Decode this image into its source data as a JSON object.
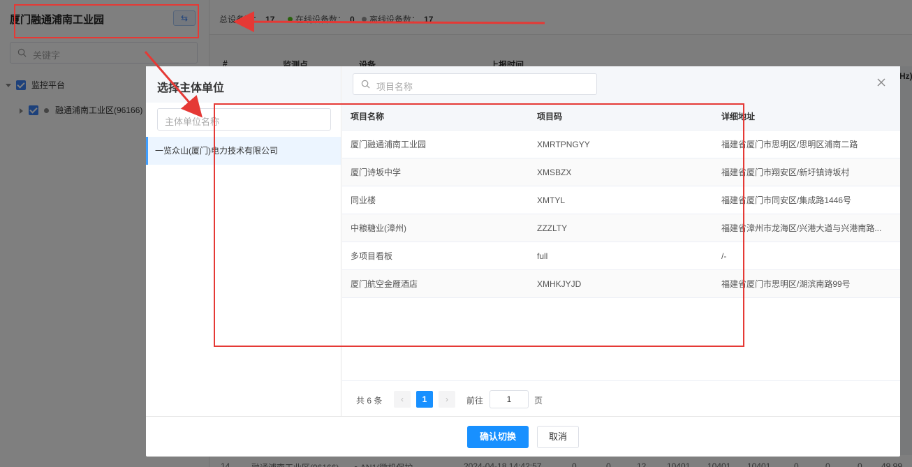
{
  "background": {
    "sidebar": {
      "title": "厦门融通浦南工业园",
      "switch_icon": "swap-icon",
      "search_placeholder": "关键字",
      "tree": [
        {
          "label": "监控平台"
        },
        {
          "label": "融通浦南工业区(96166)"
        }
      ]
    },
    "stats": [
      {
        "label": "总设备数：",
        "value": "17",
        "color": ""
      },
      {
        "label": "在线设备数：",
        "value": "0",
        "color": "#52c41a"
      },
      {
        "label": "离线设备数：",
        "value": "17",
        "color": "#999999"
      }
    ],
    "table_headers": [
      "#",
      "监测点",
      "设备",
      "上报时间",
      "Hz)"
    ],
    "bottom_row": [
      "14",
      "融通浦南工业区(96166)",
      "● AN1(微机保护",
      "2024-04-18 14:42:57",
      "0",
      "0",
      "12",
      "10401",
      "10401",
      "10401",
      "0",
      "0",
      "0",
      "49.99"
    ]
  },
  "dialog": {
    "title": "选择主体单位",
    "left_search_placeholder": "主体单位名称",
    "units": [
      {
        "name": "一览众山(厦门)电力技术有限公司"
      }
    ],
    "right_search_placeholder": "项目名称",
    "close_icon": "close-icon",
    "table": {
      "headers": [
        "项目名称",
        "项目码",
        "详细地址"
      ],
      "rows": [
        {
          "name": "厦门融通浦南工业园",
          "code": "XMRTPNGYY",
          "address": "福建省厦门市思明区/思明区浦南二路"
        },
        {
          "name": "厦门诗坂中学",
          "code": "XMSBZX",
          "address": "福建省厦门市翔安区/新圩镇诗坂村"
        },
        {
          "name": "同业楼",
          "code": "XMTYL",
          "address": "福建省厦门市同安区/集成路1446号"
        },
        {
          "name": "中粮糖业(漳州)",
          "code": "ZZZLTY",
          "address": "福建省漳州市龙海区/兴港大道与兴港南路..."
        },
        {
          "name": "多项目看板",
          "code": "full",
          "address": "/-"
        },
        {
          "name": "厦门航空金雁酒店",
          "code": "XMHKJYJD",
          "address": "福建省厦门市思明区/湖滨南路99号"
        }
      ]
    },
    "pagination": {
      "total": "共 6 条",
      "prev": "‹",
      "current": "1",
      "next": "›",
      "goto_label": "前往",
      "goto_value": "1",
      "page_suffix": "页"
    },
    "confirm_label": "确认切换",
    "cancel_label": "取消"
  },
  "annotation_color": "#e53935"
}
